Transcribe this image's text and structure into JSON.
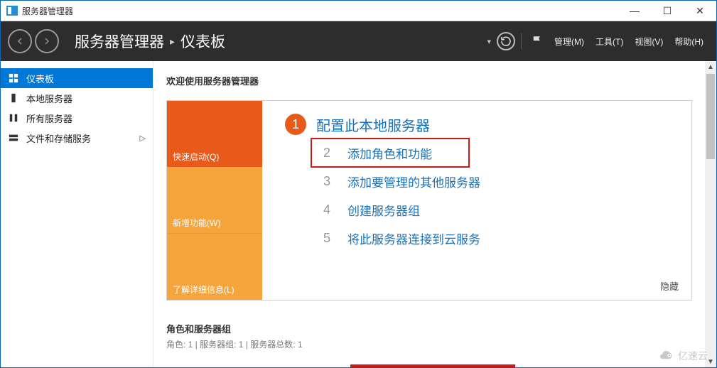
{
  "window": {
    "title": "服务器管理器"
  },
  "win_buttons": {
    "min": "—",
    "max": "☐",
    "close": "✕"
  },
  "header": {
    "breadcrumb_app": "服务器管理器",
    "breadcrumb_page": "仪表板",
    "menus": {
      "manage": "管理(M)",
      "tools": "工具(T)",
      "view": "视图(V)",
      "help": "帮助(H)"
    }
  },
  "sidebar": {
    "items": [
      {
        "label": "仪表板",
        "icon": "dashboard"
      },
      {
        "label": "本地服务器",
        "icon": "server"
      },
      {
        "label": "所有服务器",
        "icon": "servers"
      },
      {
        "label": "文件和存储服务",
        "icon": "storage",
        "has_children": true
      }
    ]
  },
  "content": {
    "welcome": "欢迎使用服务器管理器",
    "tiles": {
      "quick_start": "快速启动(Q)",
      "whats_new": "新增功能(W)",
      "learn_more": "了解详细信息(L)"
    },
    "tasks": {
      "t1": "配置此本地服务器",
      "t2": "添加角色和功能",
      "t3": "添加要管理的其他服务器",
      "t4": "创建服务器组",
      "t5": "将此服务器连接到云服务"
    },
    "nums": {
      "n1": "1",
      "n2": "2",
      "n3": "3",
      "n4": "4",
      "n5": "5"
    },
    "hide": "隐藏",
    "roles_title": "角色和服务器组",
    "roles_sub": "角色: 1 | 服务器组: 1 | 服务器总数: 1"
  },
  "watermark": "亿速云"
}
